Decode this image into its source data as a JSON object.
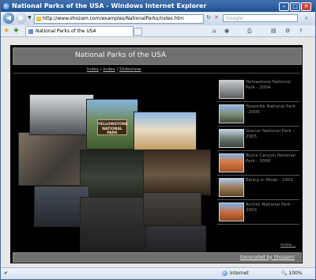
{
  "window": {
    "title": "National Parks of the USA - Windows Internet Explorer"
  },
  "address": {
    "url": "http://www.shozam.com/examples/NationalParks/index.htm"
  },
  "search": {
    "placeholder": "Google"
  },
  "tab": {
    "label": "National Parks of the USA"
  },
  "page": {
    "title": "National Parks of the USA",
    "links": [
      "Index",
      "Index",
      "Slideshow"
    ],
    "collage_sign": "YELLOWSTONE NATIONAL PARK",
    "sidebar": [
      {
        "caption": "Yellowstone National Park - 2004"
      },
      {
        "caption": "Yosemite National Park - 2005"
      },
      {
        "caption": "Glacier National Park - 2005"
      },
      {
        "caption": "Bryce Canyon National Park - 2006"
      },
      {
        "caption": "Biking in Moab - 2003"
      },
      {
        "caption": "Arches National Park - 2003"
      }
    ],
    "more_label": "more...",
    "footer": "Generated by Shozam!"
  },
  "status": {
    "zone": "Internet",
    "zoom": "100%"
  }
}
